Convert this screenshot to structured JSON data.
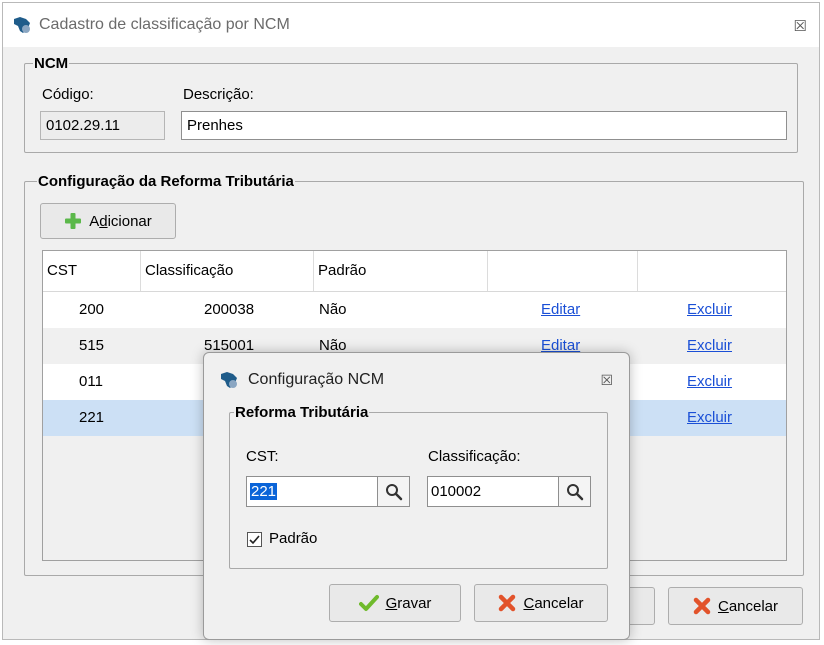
{
  "window": {
    "title": "Cadastro de classificação por NCM",
    "close_glyph": "☒"
  },
  "ncm": {
    "legend": "NCM",
    "codigo_label": "Código:",
    "codigo_value": "0102.29.11",
    "descricao_label": "Descrição:",
    "descricao_value": "Prenhes"
  },
  "reforma": {
    "legend": "Configuração da Reforma Tributária",
    "add_button": {
      "pre": "A",
      "ul": "d",
      "post": "icionar"
    },
    "columns": [
      "CST",
      "Classificação",
      "Padrão",
      "",
      ""
    ],
    "rows": [
      {
        "cst": "200",
        "classificacao": "200038",
        "padrao": "Não",
        "edit": "Editar",
        "delete": "Excluir"
      },
      {
        "cst": "515",
        "classificacao": "515001",
        "padrao": "Não",
        "edit": "Editar",
        "delete": "Excluir"
      },
      {
        "cst": "011",
        "classificacao": "",
        "padrao": "",
        "edit": "",
        "delete": "Excluir"
      },
      {
        "cst": "221",
        "classificacao": "",
        "padrao": "",
        "edit": "",
        "delete": "Excluir"
      }
    ]
  },
  "footer": {
    "cancel_button": {
      "ul": "C",
      "post": "ancelar"
    }
  },
  "dialog": {
    "title": "Configuração NCM",
    "close_glyph": "☒",
    "legend": "Reforma Tributária",
    "cst_label": "CST:",
    "cst_value": "221",
    "classificacao_label": "Classificação:",
    "classificacao_value": "010002",
    "padrao_label": "Padrão",
    "padrao_checked": true,
    "save_button": {
      "ul": "G",
      "post": "ravar"
    },
    "cancel_button": {
      "ul": "C",
      "post": "ancelar"
    }
  },
  "icons": {
    "app": "brazil-map-icon",
    "add": "plus-icon",
    "search": "search-icon",
    "save": "checkmark-icon",
    "cancel": "x-icon"
  },
  "colors": {
    "link": "#1a4fd6",
    "selected_row": "#cce0f5",
    "plus": "#5bb84a",
    "cancel_x": "#e2532b",
    "check": "#6fba2c"
  }
}
